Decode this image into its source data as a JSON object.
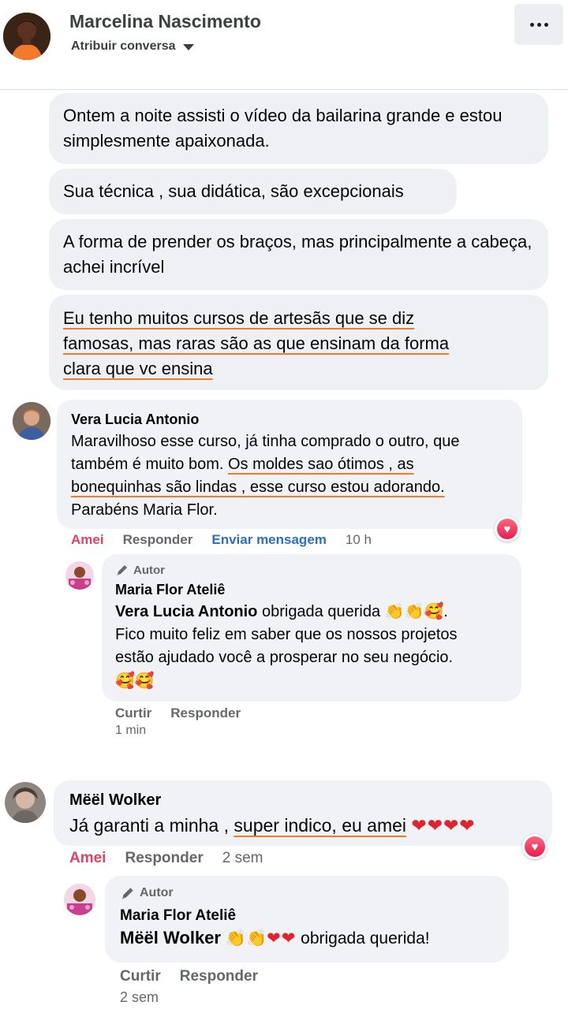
{
  "header": {
    "contact_name": "Marcelina Nascimento",
    "assign_label": "Atribuir conversa",
    "more_label": "..."
  },
  "messages": [
    {
      "text": "Ontem a noite assisti o vídeo da bailarina grande e estou simplesmente apaixonada."
    },
    {
      "text": "Sua técnica , sua didática, são excepcionais"
    },
    {
      "text": "A forma de prender os braços, mas principalmente a cabeça, achei incrível"
    },
    {
      "text_line1": "Eu tenho muitos cursos de artesãs que se diz",
      "text_line2": "famosas, mas raras são as que ensinam da forma",
      "text_line3": "clara que vc ensina"
    }
  ],
  "comments": [
    {
      "author": "Vera Lucia Antonio",
      "text_a": "Maravilhoso esse curso, já tinha comprado o outro, que",
      "text_b": "também é muito bom. ",
      "text_c": "Os moldes sao ótimos , as",
      "text_d": "bonequinhas são lindas , esse curso estou adorando.",
      "text_e": "Parabéns Maria Flor.",
      "actions": {
        "like": "Amei",
        "reply": "Responder",
        "message": "Enviar mensagem",
        "time": "10 h"
      },
      "reply": {
        "author_badge": "Autor",
        "author": "Maria Flor Ateliê",
        "mention": "Vera Lucia Antonio",
        "text_a": " obrigada querida",
        "text_b": "Fico muito feliz em saber que os nossos projetos",
        "text_c": "estão ajudado você a prosperar no seu negócio.",
        "actions": {
          "like": "Curtir",
          "reply": "Responder"
        },
        "time": "1 min"
      }
    },
    {
      "author": "Mëël Wolker",
      "text_a": "Já garanti a minha , ",
      "text_b": "super indico, eu amei",
      "actions": {
        "like": "Amei",
        "reply": "Responder",
        "time": "2 sem"
      },
      "reply": {
        "author_badge": "Autor",
        "author": "Maria Flor Ateliê",
        "mention": "Mëël Wolker",
        "text_a": " obrigada querida!",
        "actions": {
          "like": "Curtir",
          "reply": "Responder"
        },
        "time": "2 sem"
      }
    }
  ],
  "icons": {
    "heart": "heart-icon",
    "pencil": "pencil-icon",
    "clap": "clapping-hands-icon",
    "smile_hearts": "smiling-face-with-hearts-icon"
  },
  "colors": {
    "like_active": "#e4405f",
    "link_blue": "#2d6fc4",
    "underline": "#f07a2b",
    "bubble": "#f0f2f5"
  }
}
